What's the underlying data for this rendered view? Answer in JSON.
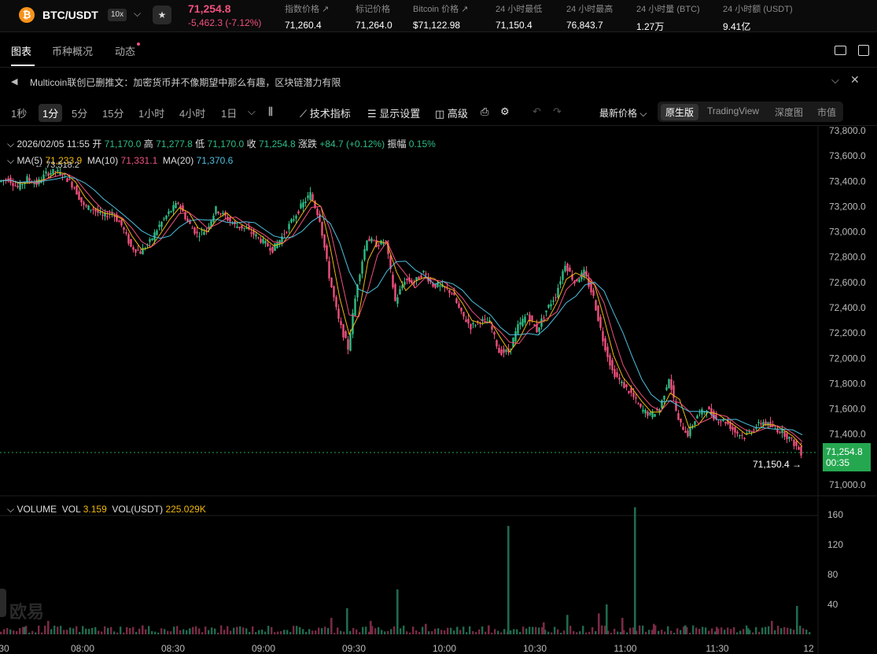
{
  "header": {
    "coin_symbol": "₿",
    "pair": "BTC/USDT",
    "leverage": "10x",
    "last_price": "71,254.8",
    "change": "-5,462.3 (-7.12%)",
    "stats": [
      {
        "label": "指数价格 ↗",
        "value": "71,260.4"
      },
      {
        "label": "标记价格",
        "value": "71,264.0"
      },
      {
        "label": "Bitcoin 价格 ↗",
        "value": "$71,122.98"
      },
      {
        "label": "24 小时最低",
        "value": "71,150.4"
      },
      {
        "label": "24 小时最高",
        "value": "76,843.7"
      },
      {
        "label": "24 小时量 (BTC)",
        "value": "1.27万"
      },
      {
        "label": "24 小时额 (USDT)",
        "value": "9.41亿"
      }
    ]
  },
  "tabs": [
    "图表",
    "币种概况",
    "动态"
  ],
  "announcement": "Multicoin联创已删推文：加密货币并不像期望中那么有趣，区块链潜力有限",
  "toolbar": {
    "timeframes": [
      "1秒",
      "1分",
      "5分",
      "15分",
      "1小时",
      "4小时",
      "1日"
    ],
    "active_timeframe": "1分",
    "tools": [
      "技术指标",
      "显示设置",
      "高级"
    ],
    "price_mode": "最新价格",
    "views": [
      "原生版",
      "TradingView",
      "深度图",
      "市值"
    ],
    "active_view": "原生版"
  },
  "chart_info": {
    "date": "2026/02/05 11:55",
    "open_label": "开",
    "open": "71,170.0",
    "high_label": "高",
    "high": "71,277.8",
    "low_label": "低",
    "low": "71,170.0",
    "close_label": "收",
    "close": "71,254.8",
    "chg_label": "涨跌",
    "chg": "+84.7 (+0.12%)",
    "amp_label": "振幅",
    "amp": "0.15%",
    "ma5_label": "MA(5)",
    "ma5": "71,233.9",
    "ma10_label": "MA(10)",
    "ma10": "71,331.1",
    "ma20_label": "MA(20)",
    "ma20": "71,370.6",
    "max_marker": "73,518.2",
    "vol_title": "VOLUME",
    "vol_label": "VOL",
    "vol": "3.159",
    "volu_label": "VOL(USDT)",
    "volu": "225.029K",
    "price_tag": "71,254.8",
    "countdown": "00:35",
    "low_marker": "71,150.4",
    "watermark": "欧易"
  },
  "chart_data": {
    "type": "candlestick",
    "x_ticks": [
      "7:30",
      "08:00",
      "08:30",
      "09:00",
      "09:30",
      "10:00",
      "10:30",
      "11:00",
      "11:30",
      "12"
    ],
    "price_ticks": [
      "73,800.0",
      "73,600.0",
      "73,400.0",
      "73,200.0",
      "73,000.0",
      "72,800.0",
      "72,600.0",
      "72,400.0",
      "72,200.0",
      "72,000.0",
      "71,800.0",
      "71,600.0",
      "71,400.0",
      "71,000.0"
    ],
    "price_ylim": [
      71000,
      73800
    ],
    "volume_ticks": [
      "160",
      "120",
      "80",
      "40"
    ],
    "volume_ylim": [
      0,
      160
    ],
    "close_path": [
      [
        0,
        73400
      ],
      [
        12,
        73420
      ],
      [
        24,
        73350
      ],
      [
        36,
        73420
      ],
      [
        48,
        73380
      ],
      [
        60,
        73460
      ],
      [
        72,
        73480
      ],
      [
        84,
        73440
      ],
      [
        96,
        73350
      ],
      [
        108,
        73200
      ],
      [
        120,
        73180
      ],
      [
        132,
        73120
      ],
      [
        144,
        73150
      ],
      [
        156,
        73050
      ],
      [
        168,
        72880
      ],
      [
        180,
        72840
      ],
      [
        192,
        72920
      ],
      [
        204,
        73050
      ],
      [
        216,
        73150
      ],
      [
        228,
        73230
      ],
      [
        240,
        73080
      ],
      [
        252,
        72980
      ],
      [
        264,
        73020
      ],
      [
        276,
        73180
      ],
      [
        288,
        73120
      ],
      [
        300,
        73050
      ],
      [
        312,
        73030
      ],
      [
        324,
        72980
      ],
      [
        336,
        72920
      ],
      [
        348,
        72860
      ],
      [
        360,
        72960
      ],
      [
        372,
        73080
      ],
      [
        384,
        73200
      ],
      [
        396,
        73300
      ],
      [
        408,
        73100
      ],
      [
        420,
        72650
      ],
      [
        432,
        72300
      ],
      [
        444,
        72080
      ],
      [
        456,
        72600
      ],
      [
        468,
        72950
      ],
      [
        480,
        72900
      ],
      [
        492,
        72920
      ],
      [
        504,
        72450
      ],
      [
        516,
        72620
      ],
      [
        528,
        72600
      ],
      [
        540,
        72680
      ],
      [
        552,
        72580
      ],
      [
        564,
        72560
      ],
      [
        576,
        72520
      ],
      [
        588,
        72350
      ],
      [
        600,
        72250
      ],
      [
        612,
        72300
      ],
      [
        624,
        72280
      ],
      [
        636,
        72050
      ],
      [
        648,
        72050
      ],
      [
        660,
        72250
      ],
      [
        672,
        72350
      ],
      [
        684,
        72220
      ],
      [
        696,
        72380
      ],
      [
        708,
        72500
      ],
      [
        720,
        72750
      ],
      [
        732,
        72600
      ],
      [
        744,
        72680
      ],
      [
        756,
        72480
      ],
      [
        768,
        72150
      ],
      [
        780,
        71900
      ],
      [
        792,
        71800
      ],
      [
        804,
        71720
      ],
      [
        816,
        71600
      ],
      [
        828,
        71550
      ],
      [
        840,
        71600
      ],
      [
        852,
        71850
      ],
      [
        864,
        71500
      ],
      [
        876,
        71400
      ],
      [
        888,
        71550
      ],
      [
        900,
        71600
      ],
      [
        912,
        71520
      ],
      [
        924,
        71500
      ],
      [
        936,
        71420
      ],
      [
        948,
        71380
      ],
      [
        960,
        71450
      ],
      [
        972,
        71500
      ],
      [
        984,
        71450
      ],
      [
        996,
        71420
      ],
      [
        1008,
        71350
      ],
      [
        1020,
        71255
      ]
    ],
    "volume_bars": [
      [
        30,
        10
      ],
      [
        60,
        18
      ],
      [
        120,
        6
      ],
      [
        180,
        12
      ],
      [
        240,
        8
      ],
      [
        300,
        10
      ],
      [
        360,
        6
      ],
      [
        420,
        22
      ],
      [
        440,
        35
      ],
      [
        470,
        18
      ],
      [
        504,
        60
      ],
      [
        540,
        14
      ],
      [
        580,
        10
      ],
      [
        620,
        12
      ],
      [
        645,
        145
      ],
      [
        690,
        16
      ],
      [
        720,
        26
      ],
      [
        760,
        28
      ],
      [
        770,
        40
      ],
      [
        790,
        22
      ],
      [
        806,
        170
      ],
      [
        830,
        14
      ],
      [
        870,
        12
      ],
      [
        910,
        10
      ],
      [
        950,
        8
      ],
      [
        980,
        18
      ],
      [
        1012,
        38
      ]
    ]
  }
}
